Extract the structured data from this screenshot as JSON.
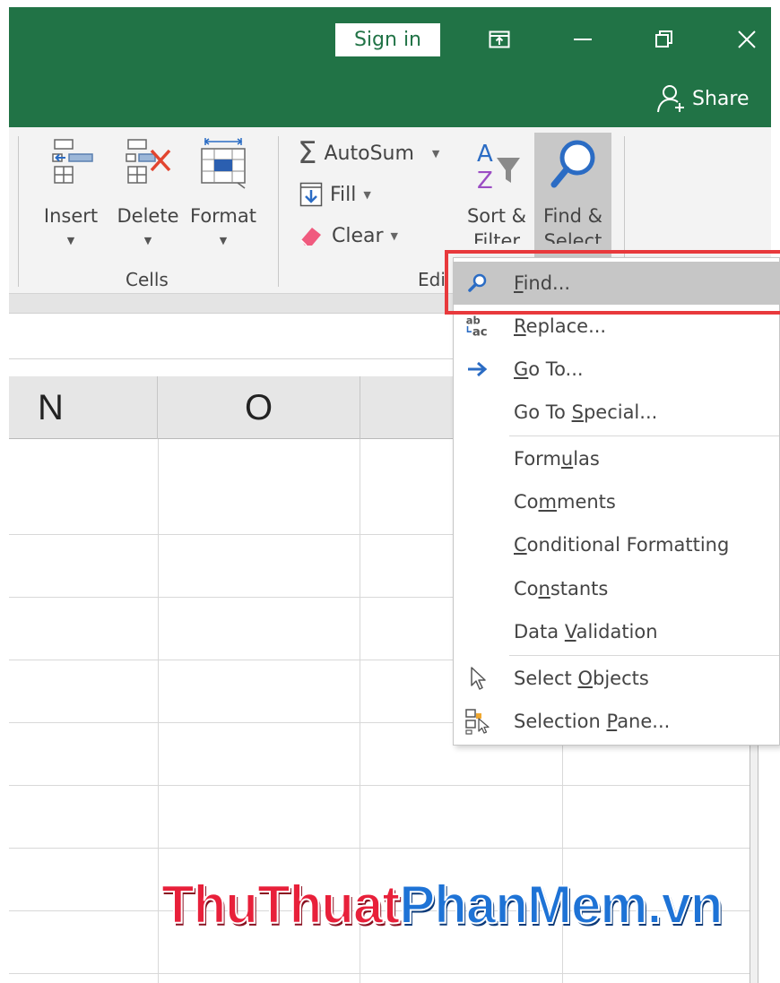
{
  "titlebar": {
    "sign_in_label": "Sign in",
    "share_label": "Share",
    "icons": [
      "ribbon-display-options-icon",
      "minimize-icon",
      "restore-icon",
      "close-icon",
      "share-person-icon"
    ]
  },
  "ribbon": {
    "cells_group": {
      "label": "Cells",
      "buttons": [
        {
          "label": "Insert",
          "icon": "insert-cells-icon"
        },
        {
          "label": "Delete",
          "icon": "delete-cells-icon"
        },
        {
          "label": "Format",
          "icon": "format-cells-icon"
        }
      ]
    },
    "editing_group": {
      "label": "Edi",
      "autosum_label": "AutoSum",
      "fill_label": "Fill",
      "clear_label": "Clear",
      "sort_filter": {
        "line1": "Sort &",
        "line2": "Filter"
      },
      "find_select": {
        "line1": "Find &",
        "line2": "Select"
      }
    }
  },
  "sheet": {
    "columns": [
      "N",
      "O"
    ]
  },
  "menu": {
    "items": [
      {
        "pre": "",
        "acc": "F",
        "post": "ind...",
        "icon": "search-icon",
        "highlighted": true
      },
      {
        "pre": "",
        "acc": "R",
        "post": "eplace...",
        "icon": "replace-icon"
      },
      {
        "pre": "",
        "acc": "G",
        "post": "o To...",
        "icon": "arrow-right-icon"
      },
      {
        "pre": "Go To ",
        "acc": "S",
        "post": "pecial..."
      },
      {
        "pre": "Form",
        "acc": "u",
        "post": "las"
      },
      {
        "pre": "Co",
        "acc": "m",
        "post": "ments"
      },
      {
        "pre": "",
        "acc": "C",
        "post": "onditional Formatting"
      },
      {
        "pre": "Co",
        "acc": "n",
        "post": "stants"
      },
      {
        "pre": "Data ",
        "acc": "V",
        "post": "alidation"
      },
      {
        "pre": "Select ",
        "acc": "O",
        "post": "bjects",
        "icon": "cursor-arrow-icon"
      },
      {
        "pre": "Selection ",
        "acc": "P",
        "post": "ane...",
        "icon": "selection-pane-icon"
      }
    ],
    "highlight_color": "#e8393c"
  },
  "watermark": {
    "part1": "ThuThuat",
    "part2": "PhanMem.vn"
  },
  "colors": {
    "excel_green": "#217346",
    "ribbon_bg": "#f3f3f3",
    "menu_hover": "#c6c6c6",
    "watermark_red": "#e8203a",
    "watermark_blue": "#1e73d6"
  }
}
